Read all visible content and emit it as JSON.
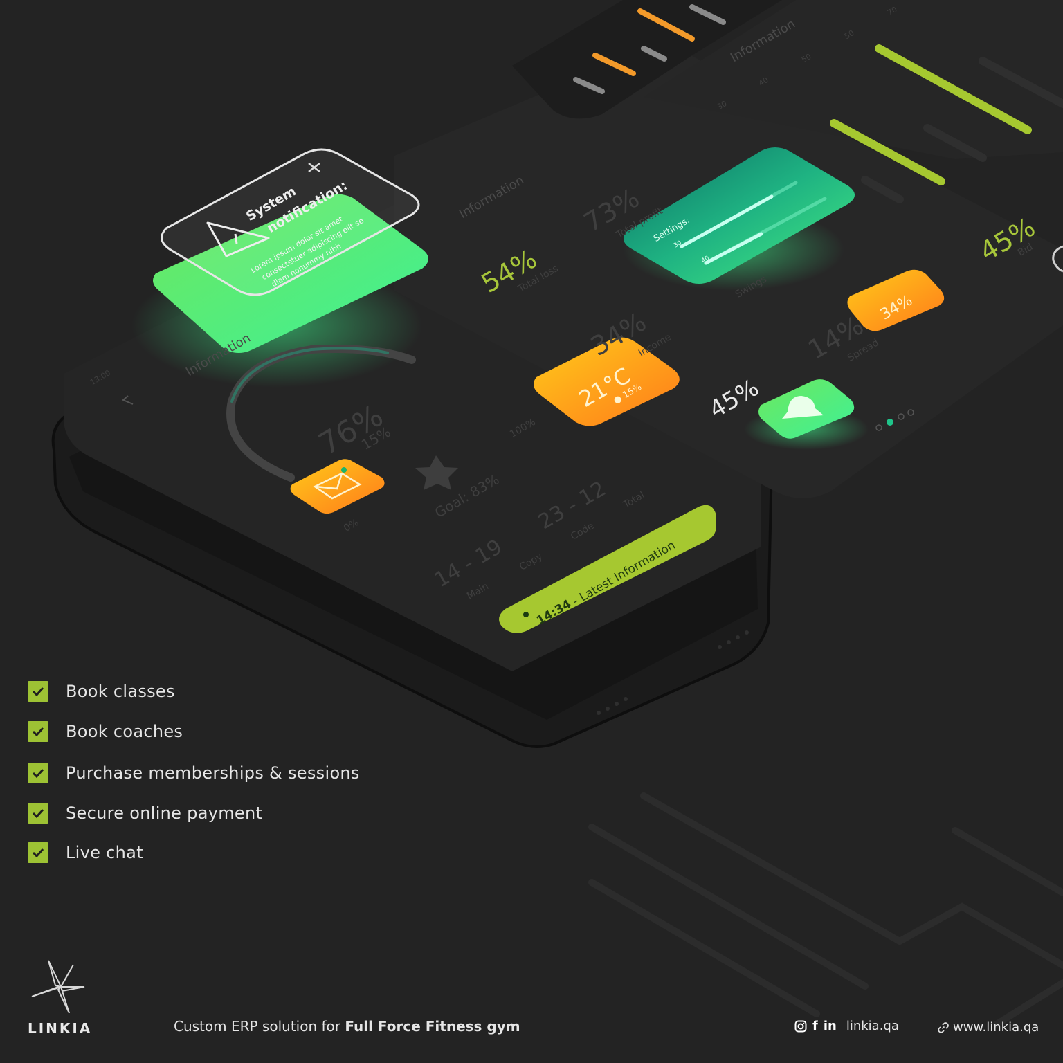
{
  "features": [
    "Book classes",
    "Book coaches",
    "Purchase memberships & sessions",
    "Secure online payment",
    "Live chat"
  ],
  "mockup": {
    "notification_title_1": "System",
    "notification_title_2": "notification:",
    "notification_body_1": "Lorem ipsum dolor sit amet",
    "notification_body_2": "consectetuer adipiscing elit se",
    "notification_body_3": "diam nonummy nibh",
    "info_label": "Information",
    "stat_54": "54%",
    "stat_54_label": "Total loss",
    "stat_73": "73%",
    "stat_73_label": "Total profit",
    "stat_34": "34%",
    "stat_34_label": "Income",
    "stat_14": "14%",
    "stat_14_label": "Spread",
    "stat_45": "45%",
    "stat_45_top": "45%",
    "stat_45_top_label": "Bid",
    "badge_34": "34%",
    "weather_temp": "21°C",
    "weather_humidity": "15%",
    "settings_label": "Settings:",
    "settings_val_1": "30",
    "settings_val_2": "40",
    "swings_label": "Swings",
    "gauge_value": "76%",
    "gauge_sub": "15%",
    "gauge_zero": "0%",
    "gauge_hundred": "100%",
    "goal": "Goal: 83%",
    "time_left": "13:00",
    "range_1": "14 - 19",
    "range_1_label": "Main",
    "range_2": "23 - 12",
    "copy_label": "Copy",
    "code_label": "Code",
    "total_label": "Total",
    "latest_time": "14:34",
    "latest_text": "- Latest Information",
    "axis_40": "40",
    "axis_50": "50",
    "axis_60": "50",
    "axis_70": "70",
    "axis_30": "30"
  },
  "footer": {
    "brand": "LINKIA",
    "tagline_prefix": "Custom ERP solution for ",
    "tagline_bold": "Full Force Fitness gym",
    "handle": "linkia.qa",
    "website": "www.linkia.qa"
  },
  "colors": {
    "background": "#232323",
    "lime": "#9dc234",
    "green_glow": "#4ef08a",
    "orange": "#f7a21b"
  }
}
